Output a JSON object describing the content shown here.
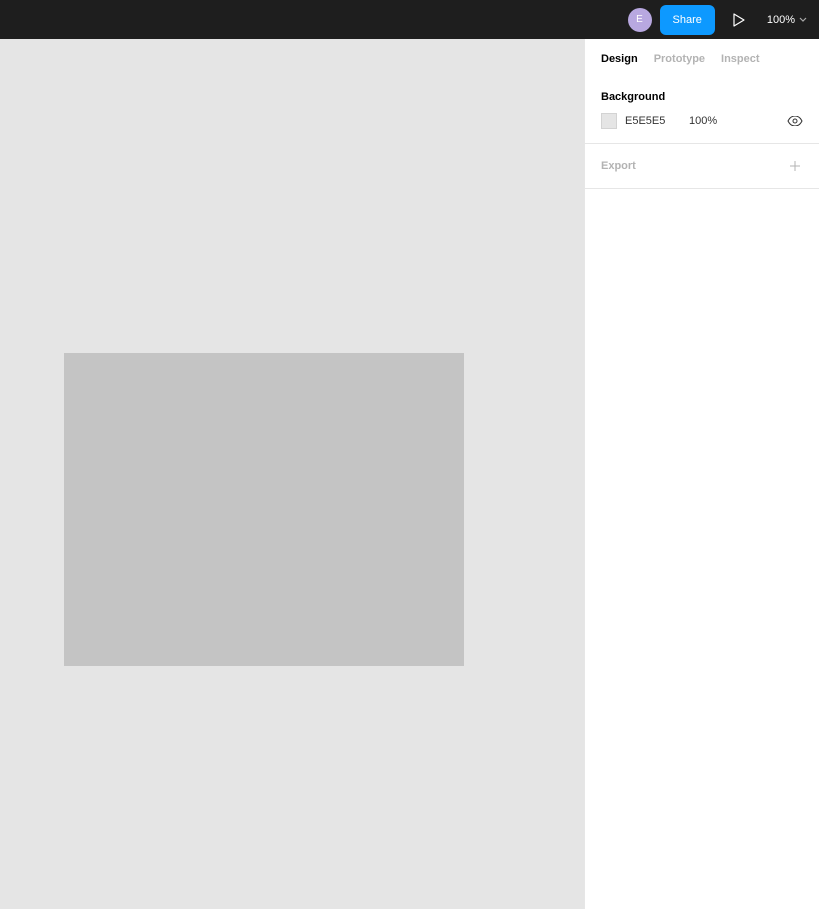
{
  "topbar": {
    "avatar_initial": "E",
    "share_label": "Share",
    "zoom_value": "100%"
  },
  "sidebar": {
    "tabs": [
      {
        "label": "Design",
        "active": true
      },
      {
        "label": "Prototype",
        "active": false
      },
      {
        "label": "Inspect",
        "active": false
      }
    ],
    "background": {
      "title": "Background",
      "hex": "E5E5E5",
      "opacity": "100%"
    },
    "export": {
      "label": "Export"
    }
  },
  "canvas": {
    "background_color": "#e5e5e5",
    "rect_color": "#c4c4c4"
  }
}
